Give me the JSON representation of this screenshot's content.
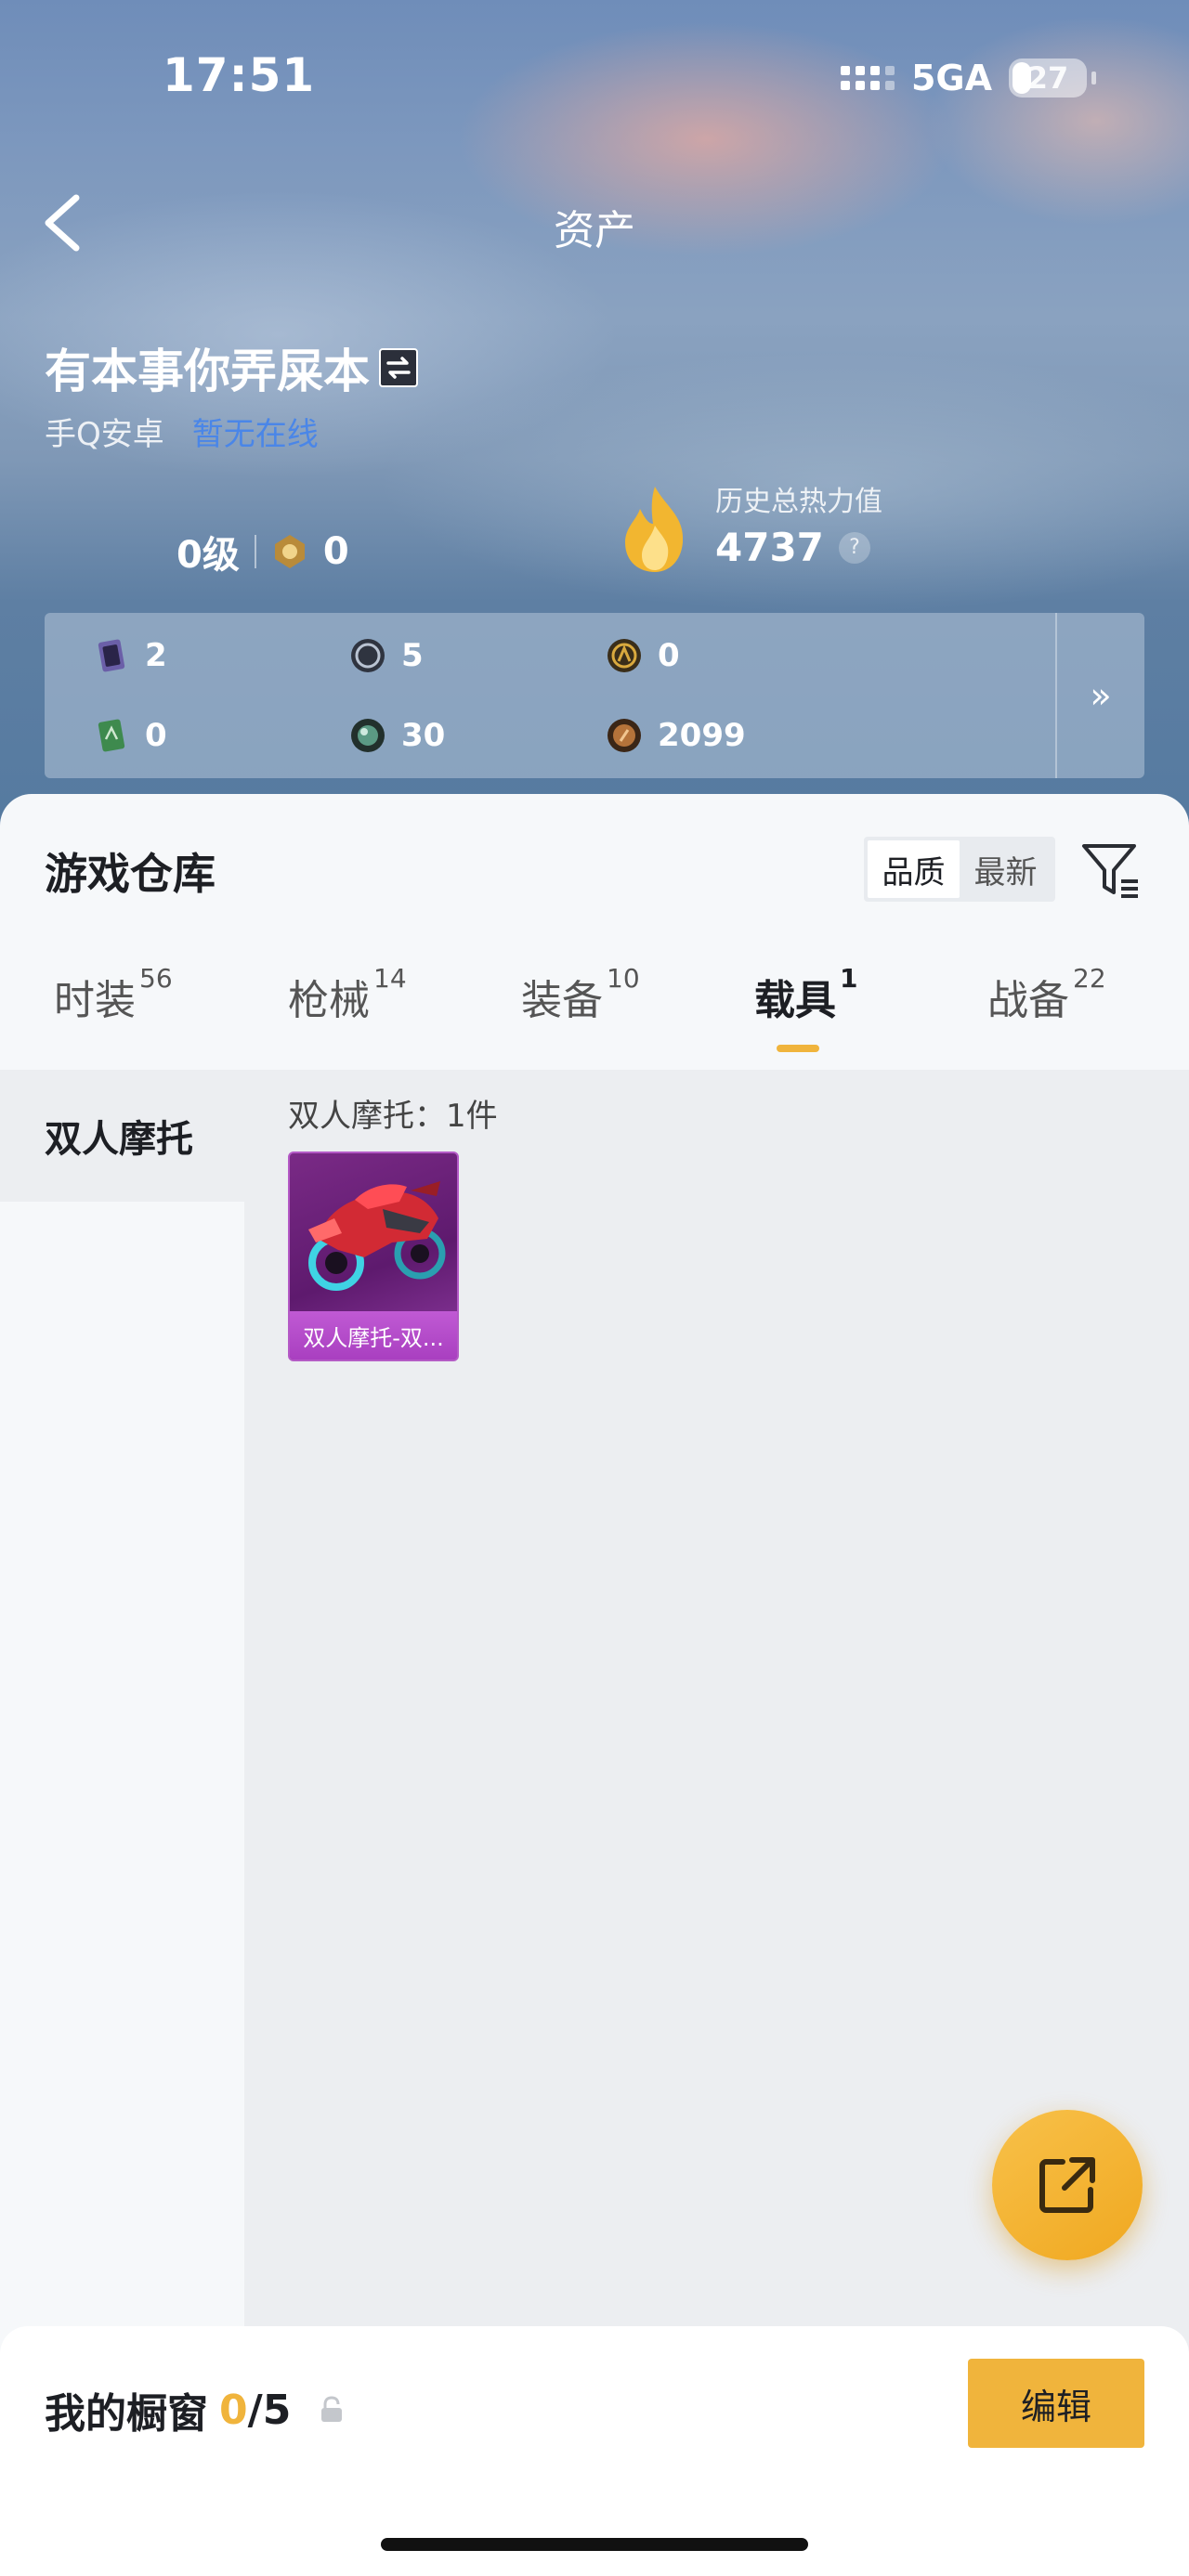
{
  "status_bar": {
    "time": "17:51",
    "network": "5GA",
    "battery": "27"
  },
  "header": {
    "title": "资产"
  },
  "profile": {
    "username": "有本事你弄屎本",
    "platform": "手Q安卓",
    "online_status": "暂无在线",
    "level": "0级",
    "badge_count": "0",
    "power_label": "历史总热力值",
    "power_value": "4737",
    "help_glyph": "?"
  },
  "currencies": [
    {
      "name": "card-purple",
      "value": "2",
      "color": "#6b5fa8"
    },
    {
      "name": "coin-silver",
      "value": "5",
      "color": "#4a5060"
    },
    {
      "name": "coin-gold",
      "value": "0",
      "color": "#b88a2a"
    },
    {
      "name": "card-green",
      "value": "0",
      "color": "#3e8a4e"
    },
    {
      "name": "orb-teal",
      "value": "30",
      "color": "#3d6d5f"
    },
    {
      "name": "coin-bronze",
      "value": "2099",
      "color": "#a0622a"
    }
  ],
  "currency_more": "»",
  "warehouse": {
    "title": "游戏仓库",
    "sort_options": [
      "品质",
      "最新"
    ],
    "tabs": [
      {
        "label": "时装",
        "count": "56"
      },
      {
        "label": "枪械",
        "count": "14"
      },
      {
        "label": "装备",
        "count": "10"
      },
      {
        "label": "载具",
        "count": "1"
      },
      {
        "label": "战备",
        "count": "22"
      }
    ],
    "sidebar_items": [
      "双人摩托"
    ],
    "count_label": "双人摩托：1件",
    "items": [
      {
        "name": "双人摩托-双..."
      }
    ]
  },
  "showcase": {
    "label": "我的橱窗",
    "count": "0",
    "total": "/5",
    "edit_label": "编辑"
  }
}
